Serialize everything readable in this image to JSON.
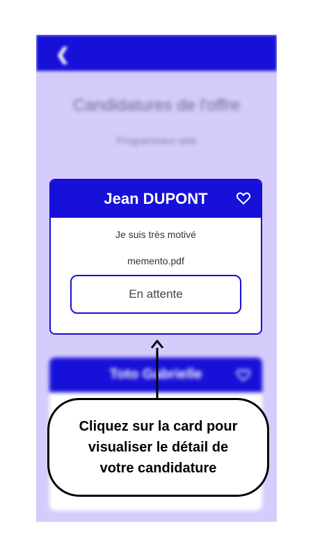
{
  "header": {
    "back_icon": "arrow-left-icon"
  },
  "page": {
    "title": "Candidatures de l'offre",
    "subtitle": "Programmeur web"
  },
  "card": {
    "name": "Jean DUPONT",
    "favorite_icon": "heart-icon",
    "message": "Je suis très motivé",
    "file": "memento.pdf",
    "status": "En attente"
  },
  "card2": {
    "name": "Toto Gabrielle",
    "favorite_icon": "heart-icon"
  },
  "tooltip": {
    "lines": [
      "Cliquez sur la card pour",
      "visualiser le détail de",
      "votre candidature"
    ]
  },
  "colors": {
    "primary": "#1710d8",
    "background": "#d6ccfb"
  }
}
